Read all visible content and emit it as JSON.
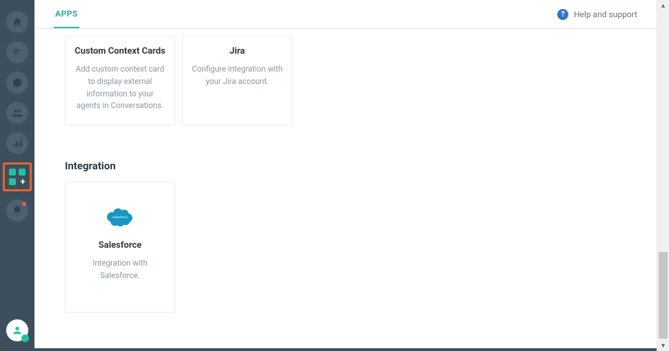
{
  "topbar": {
    "tab_label": "APPS",
    "help_label": "Help and support"
  },
  "cards": {
    "row1": [
      {
        "title": "Custom Context Cards",
        "desc": "Add custom context card to display external information to your agents in Conversations."
      },
      {
        "title": "Jira",
        "desc": "Configure integration with your Jira account."
      }
    ]
  },
  "section": {
    "heading": "Integration"
  },
  "integration_card": {
    "title": "Salesforce",
    "desc": "Integration with Salesforce.",
    "cloud_text": "salesforce"
  }
}
